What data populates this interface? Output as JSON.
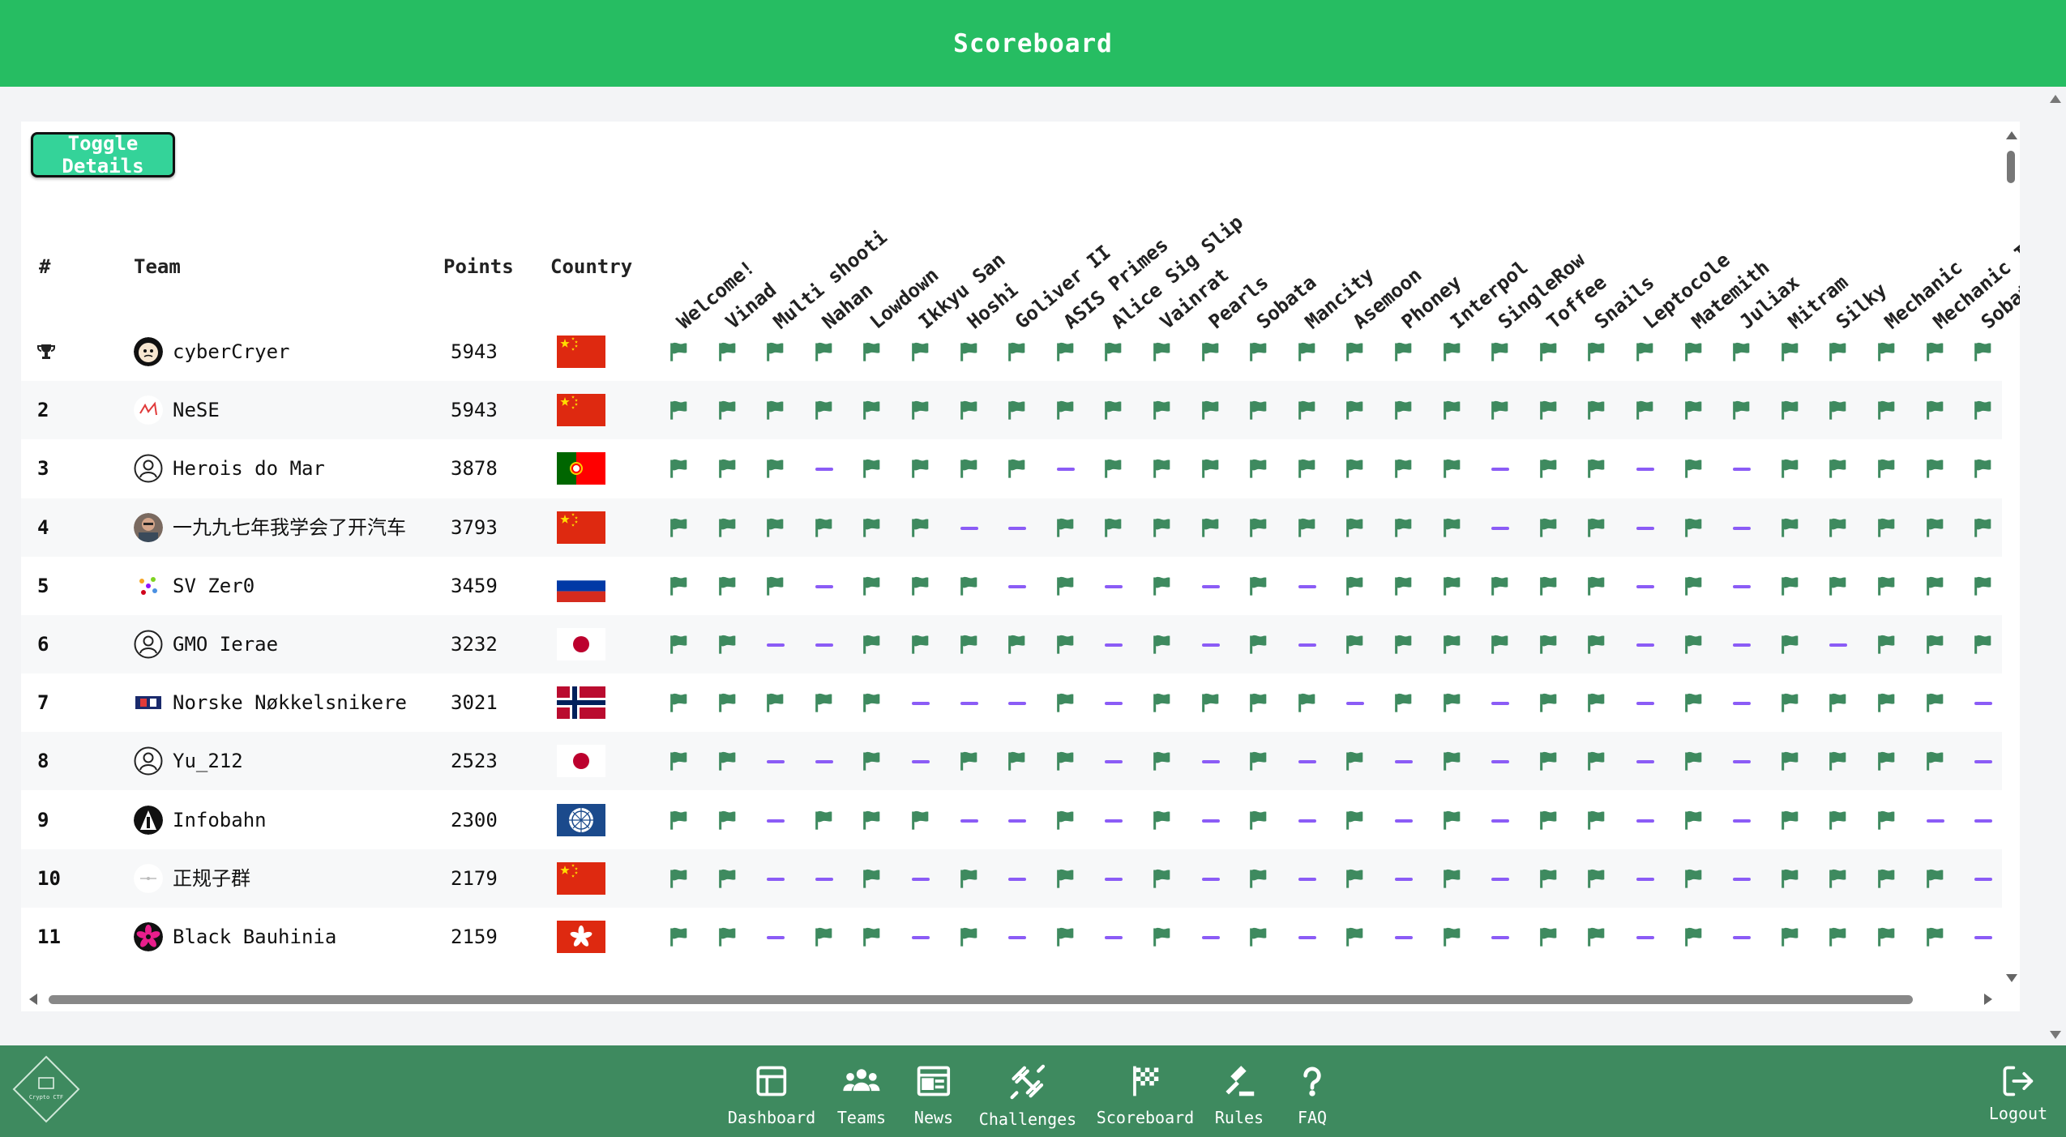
{
  "header": {
    "title": "Scoreboard"
  },
  "toolbar": {
    "toggle_label": "Toggle Details"
  },
  "table": {
    "columns": {
      "rank": "#",
      "team": "Team",
      "points": "Points",
      "country": "Country"
    },
    "challenges": [
      "Welcome!",
      "Vinad",
      "Multi shooti",
      "Nahan",
      "Lowdown",
      "Ikkyu San",
      "Hoshi",
      "Goliver II",
      "ASIS Primes",
      "Alice Sig Slip",
      "Vainrat",
      "Pearls",
      "Sobata",
      "Mancity",
      "Asemoon",
      "Phoney",
      "Interpol",
      "SingleRow",
      "Toffee",
      "Snails",
      "Leptocole",
      "Matemith",
      "Juliax",
      "Mitram",
      "Silky",
      "Mechanic",
      "Mechanic II",
      "Sobata"
    ],
    "rows": [
      {
        "rank": "trophy",
        "name": "cyberCryer",
        "points": "5943",
        "country": "cn",
        "avatar": "cybercryer",
        "solves": "1111111111111111111111111111"
      },
      {
        "rank": "2",
        "name": "NeSE",
        "points": "5943",
        "country": "cn",
        "avatar": "nese",
        "solves": "1111111111111111111111111111"
      },
      {
        "rank": "3",
        "name": "Herois do Mar",
        "points": "3878",
        "country": "pt",
        "avatar": "default",
        "solves": "1110111101111111101101011111"
      },
      {
        "rank": "4",
        "name": "一九九七年我学会了开汽车",
        "points": "3793",
        "country": "cn",
        "avatar": "photo",
        "solves": "1111110011111111101101011111"
      },
      {
        "rank": "5",
        "name": "SV Zer0",
        "points": "3459",
        "country": "ru",
        "avatar": "sv",
        "solves": "1110111010101011111101011111"
      },
      {
        "rank": "6",
        "name": "GMO Ierae",
        "points": "3232",
        "country": "jp",
        "avatar": "default",
        "solves": "1100111110101011111101010111"
      },
      {
        "rank": "7",
        "name": "Norske Nøkkelsnikere",
        "points": "3021",
        "country": "no",
        "avatar": "norske",
        "solves": "1111100010111101101101011110"
      },
      {
        "rank": "8",
        "name": "Yu_212",
        "points": "2523",
        "country": "jp",
        "avatar": "default",
        "solves": "1100101110101010101101011110"
      },
      {
        "rank": "9",
        "name": "Infobahn",
        "points": "2300",
        "country": "aq",
        "avatar": "infobahn",
        "solves": "1101110010101010101101011100"
      },
      {
        "rank": "10",
        "name": "正规子群",
        "points": "2179",
        "country": "cn",
        "avatar": "zgzq",
        "solves": "1100101010101010101101011110"
      },
      {
        "rank": "11",
        "name": "Black Bauhinia",
        "points": "2159",
        "country": "hk",
        "avatar": "bauhinia",
        "solves": "1101101010101010101101011110"
      }
    ]
  },
  "nav": [
    {
      "label": "Dashboard",
      "icon": "dashboard-icon"
    },
    {
      "label": "Teams",
      "icon": "teams-icon"
    },
    {
      "label": "News",
      "icon": "news-icon"
    },
    {
      "label": "Challenges",
      "icon": "challenges-icon"
    },
    {
      "label": "Scoreboard",
      "icon": "scoreboard-icon"
    },
    {
      "label": "Rules",
      "icon": "rules-icon"
    },
    {
      "label": "FAQ",
      "icon": "faq-icon"
    }
  ],
  "logout_label": "Logout",
  "logo_text": "Crypto CTF",
  "colors": {
    "header": "#26bd62",
    "footer": "#3e8a5f",
    "solved_flag": "#3e8a5f",
    "unsolved_dash": "#8b5cf6",
    "button": "#34d399"
  }
}
